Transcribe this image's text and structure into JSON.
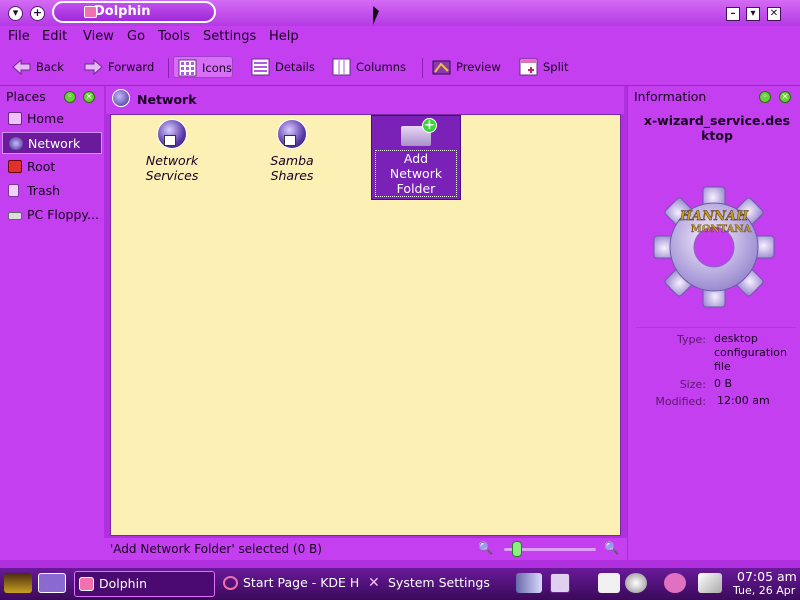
{
  "window": {
    "title": "Dolphin"
  },
  "menu": [
    "File",
    "Edit",
    "View",
    "Go",
    "Tools",
    "Settings",
    "Help"
  ],
  "toolbar": {
    "back": "Back",
    "forward": "Forward",
    "icons": "Icons",
    "details": "Details",
    "columns": "Columns",
    "preview": "Preview",
    "split": "Split"
  },
  "places": {
    "header": "Places",
    "items": [
      "Home",
      "Network",
      "Root",
      "Trash",
      "PC Floppy..."
    ],
    "selected": "Network"
  },
  "breadcrumb": {
    "current": "Network"
  },
  "files": [
    {
      "name": "Network\nServices",
      "icon": "network-globe-icon"
    },
    {
      "name": "Samba Shares",
      "icon": "network-globe-icon"
    },
    {
      "name": "Add Network\nFolder",
      "icon": "add-folder-icon",
      "selected": true
    }
  ],
  "info": {
    "header": "Information",
    "filename": "x-wizard_service.desktop",
    "icon_text": "HANNAH MONTANA",
    "type_label": "Type:",
    "type_value": "desktop configuration file",
    "size_label": "Size:",
    "size_value": "0 B",
    "modified_label": "Modified:",
    "modified_value": "12:00 am"
  },
  "status": {
    "text": "'Add Network Folder' selected (0 B)",
    "zoom_level": 0.1
  },
  "taskbar": {
    "tasks": [
      "Dolphin",
      "Start Page - KDE H",
      "System Settings"
    ],
    "time": "07:05 am",
    "date": "Tue, 26 Apr"
  },
  "colors": {
    "accent": "#c43ff0",
    "files_bg": "#fcf0b4",
    "selection": "#7a22b8"
  }
}
